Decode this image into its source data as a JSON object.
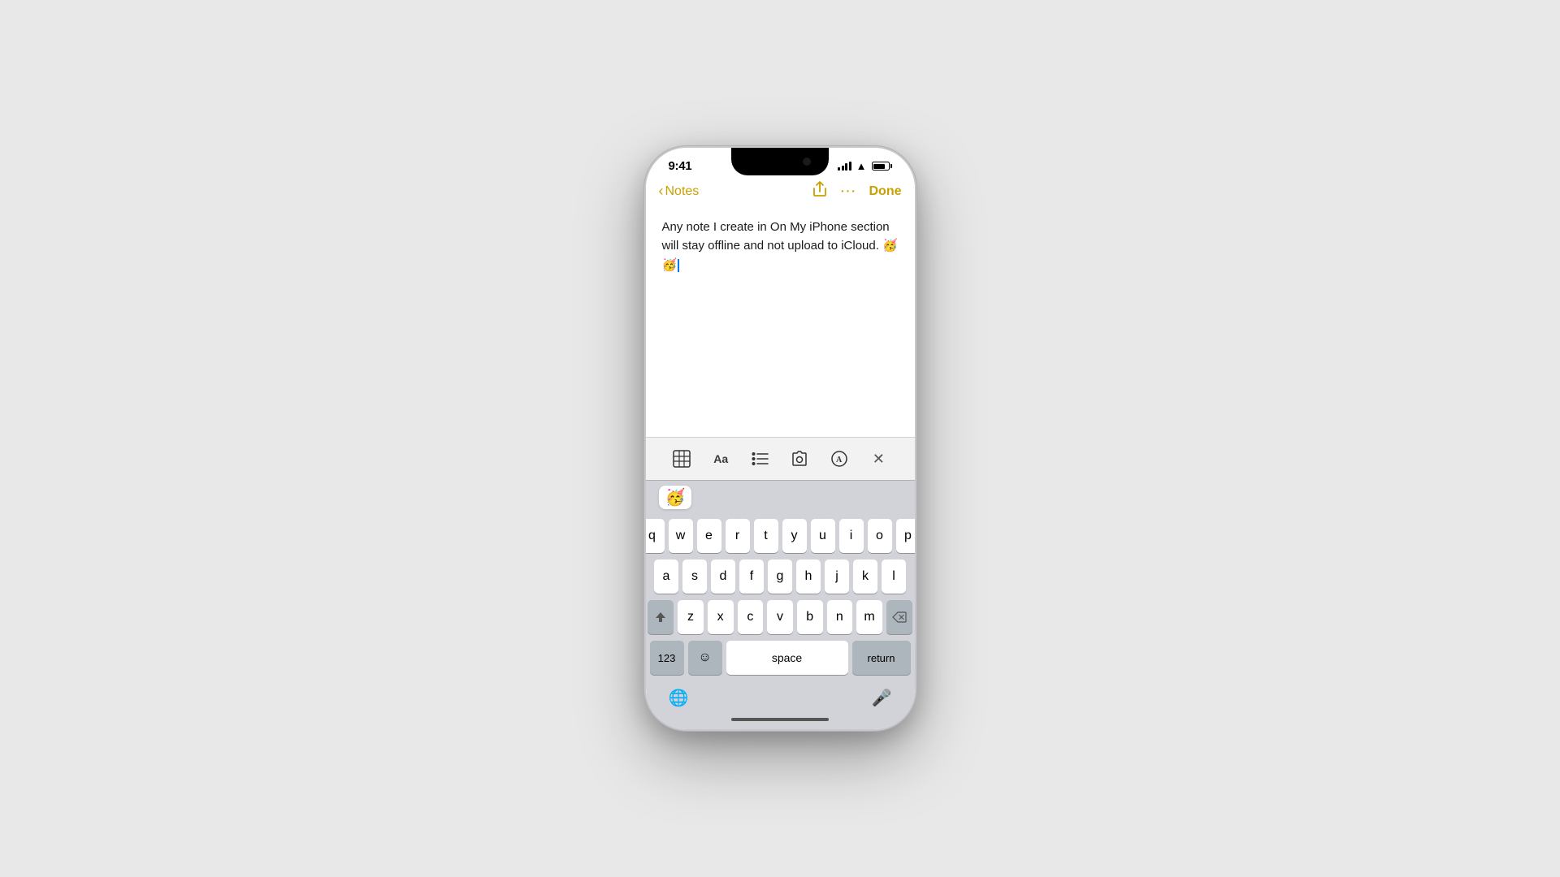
{
  "background_color": "#e8e8e8",
  "phone": {
    "status_bar": {
      "time": "9:41",
      "signal_bars": 4,
      "wifi": true,
      "battery": "full"
    },
    "nav": {
      "back_label": "Notes",
      "done_label": "Done"
    },
    "note": {
      "content": "Any note I create in On My iPhone section will stay offline and not upload to iCloud. 🥳🥳"
    },
    "format_toolbar": {
      "table_icon": "⊞",
      "text_icon": "Aa",
      "list_icon": "≡",
      "camera_icon": "⊙",
      "find_icon": "Ⓐ",
      "close_icon": "✕"
    },
    "emoji_suggestion": "🥳",
    "keyboard": {
      "rows": [
        [
          "q",
          "w",
          "e",
          "r",
          "t",
          "y",
          "u",
          "i",
          "o",
          "p"
        ],
        [
          "a",
          "s",
          "d",
          "f",
          "g",
          "h",
          "j",
          "k",
          "l"
        ],
        [
          "shift",
          "z",
          "x",
          "c",
          "v",
          "b",
          "n",
          "m",
          "delete"
        ],
        [
          "123",
          "emoji",
          "space",
          "return"
        ]
      ],
      "space_label": "space",
      "return_label": "return",
      "numbers_label": "123"
    },
    "bottom_bar": {
      "globe_icon": "🌐",
      "mic_icon": "🎤"
    }
  }
}
